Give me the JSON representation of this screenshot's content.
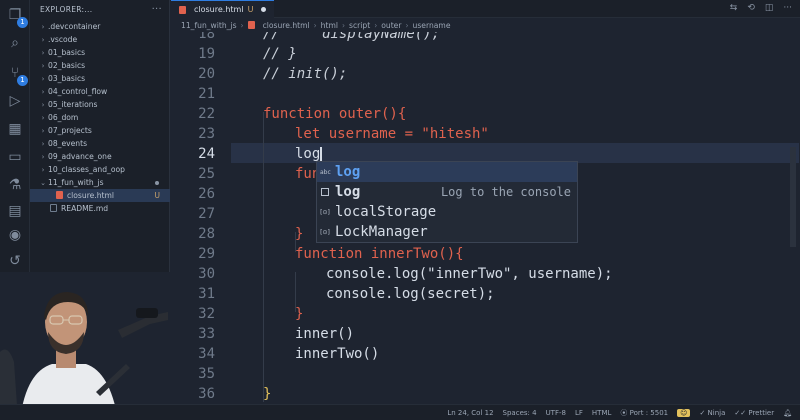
{
  "activity_bar": {
    "icons": [
      "files-icon",
      "search-icon",
      "source-control-icon",
      "run-debug-icon",
      "extensions-icon",
      "remote-explorer-icon",
      "testing-icon",
      "docker-icon",
      "github-icon",
      "live-share-icon"
    ],
    "badges": {
      "files": "1",
      "source_control": "1"
    }
  },
  "sidebar": {
    "title": "EXPLORER:...",
    "items": [
      {
        "label": ".devcontainer",
        "type": "folder"
      },
      {
        "label": ".vscode",
        "type": "folder"
      },
      {
        "label": "01_basics",
        "type": "folder"
      },
      {
        "label": "02_basics",
        "type": "folder"
      },
      {
        "label": "03_basics",
        "type": "folder"
      },
      {
        "label": "04_control_flow",
        "type": "folder"
      },
      {
        "label": "05_iterations",
        "type": "folder"
      },
      {
        "label": "06_dom",
        "type": "folder"
      },
      {
        "label": "07_projects",
        "type": "folder"
      },
      {
        "label": "08_events",
        "type": "folder"
      },
      {
        "label": "09_advance_one",
        "type": "folder"
      },
      {
        "label": "10_classes_and_oop",
        "type": "folder"
      },
      {
        "label": "11_fun_with_js",
        "type": "folder-open"
      },
      {
        "label": "closure.html",
        "type": "html",
        "status": "U"
      },
      {
        "label": "README.md",
        "type": "md"
      }
    ]
  },
  "tab": {
    "label": "closure.html",
    "status": "U"
  },
  "breadcrumb": [
    "11_fun_with_js",
    "closure.html",
    "html",
    "script",
    "outer",
    "username"
  ],
  "editor": {
    "lines": [
      {
        "n": "18",
        "text": "//     displayName();"
      },
      {
        "n": "19",
        "text": "// }"
      },
      {
        "n": "20",
        "text": "// init();"
      },
      {
        "n": "21",
        "text": ""
      },
      {
        "n": "22",
        "text": "function outer(){"
      },
      {
        "n": "23",
        "text": "let username = \"hitesh\""
      },
      {
        "n": "24",
        "text": "log"
      },
      {
        "n": "25",
        "text": "fun"
      },
      {
        "n": "26",
        "text": ""
      },
      {
        "n": "27",
        "text": ""
      },
      {
        "n": "28",
        "text": "}"
      },
      {
        "n": "29",
        "text": "function innerTwo(){"
      },
      {
        "n": "30",
        "text": "console.log(\"innerTwo\", username);"
      },
      {
        "n": "31",
        "text": "console.log(secret);"
      },
      {
        "n": "32",
        "text": "}"
      },
      {
        "n": "33",
        "text": "inner()"
      },
      {
        "n": "34",
        "text": "innerTwo()"
      },
      {
        "n": "35",
        "text": ""
      },
      {
        "n": "36",
        "text": "}"
      }
    ]
  },
  "suggestions": [
    {
      "label": "log",
      "icon": "abc-icon",
      "detail": ""
    },
    {
      "label": "log",
      "icon": "snippet-icon",
      "detail": "Log to the console"
    },
    {
      "label": "localStorage",
      "icon": "variable-icon",
      "detail": ""
    },
    {
      "label": "LockManager",
      "icon": "variable-icon",
      "detail": ""
    }
  ],
  "status_bar": {
    "position": "Ln 24, Col 12",
    "spaces": "Spaces: 4",
    "encoding": "UTF-8",
    "eol": "LF",
    "language": "HTML",
    "port": "Port : 5501",
    "ninja": "Ninja",
    "prettier": "Prettier"
  },
  "colors": {
    "accent": "#2f7de1",
    "keyword": "#e0624e",
    "bracket": "#e3c15c",
    "suggest_match": "#5ea1f2"
  }
}
